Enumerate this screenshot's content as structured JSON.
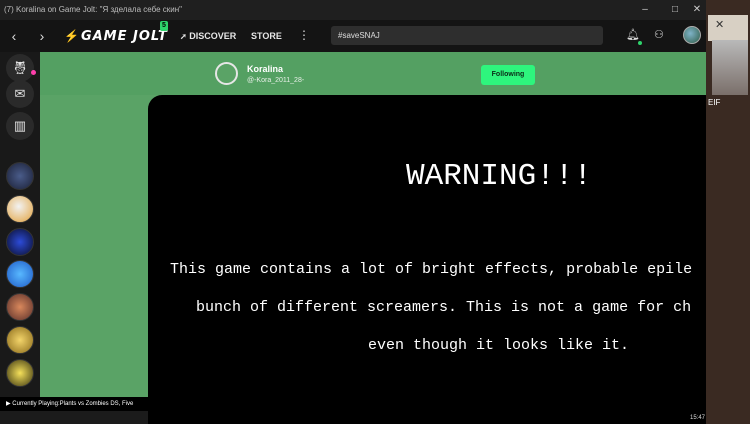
{
  "window": {
    "title": "(7) Koralina on Game Jolt: \"Я зделала себе скин\"",
    "minimize": "–",
    "maximize": "□",
    "close": "✕"
  },
  "nav": {
    "back": "‹",
    "forward": "›",
    "logo_text": "GAME JOLT",
    "logo_badge": "5",
    "discover": "DISCOVER",
    "store": "STORE",
    "more": "⋮",
    "search_value": "#saveSNAJ"
  },
  "profile": {
    "name": "Koralina",
    "handle": "@-Kora_2011_28-",
    "follow_button": "Following"
  },
  "warning": {
    "title": "WARNING!!!",
    "line1": "This game contains a lot of bright effects, probable epile",
    "line2": "bunch of different screamers. This is not a game for ch",
    "line3": "even though it looks like it."
  },
  "status": {
    "now_playing": "Currently Playing:Plants vs Zombies DS, Five"
  },
  "right_strip": {
    "label": "EIF"
  },
  "clock": {
    "time": "15:47"
  },
  "colors": {
    "accent_green": "#2ef57d",
    "page_green": "#5aa366",
    "notification_pink": "#ff3fac"
  },
  "icons": {
    "sidebar": [
      "owl-icon",
      "chat-icon",
      "library-icon"
    ],
    "nav": [
      "bell-icon",
      "friends-icon",
      "user-avatar"
    ]
  }
}
